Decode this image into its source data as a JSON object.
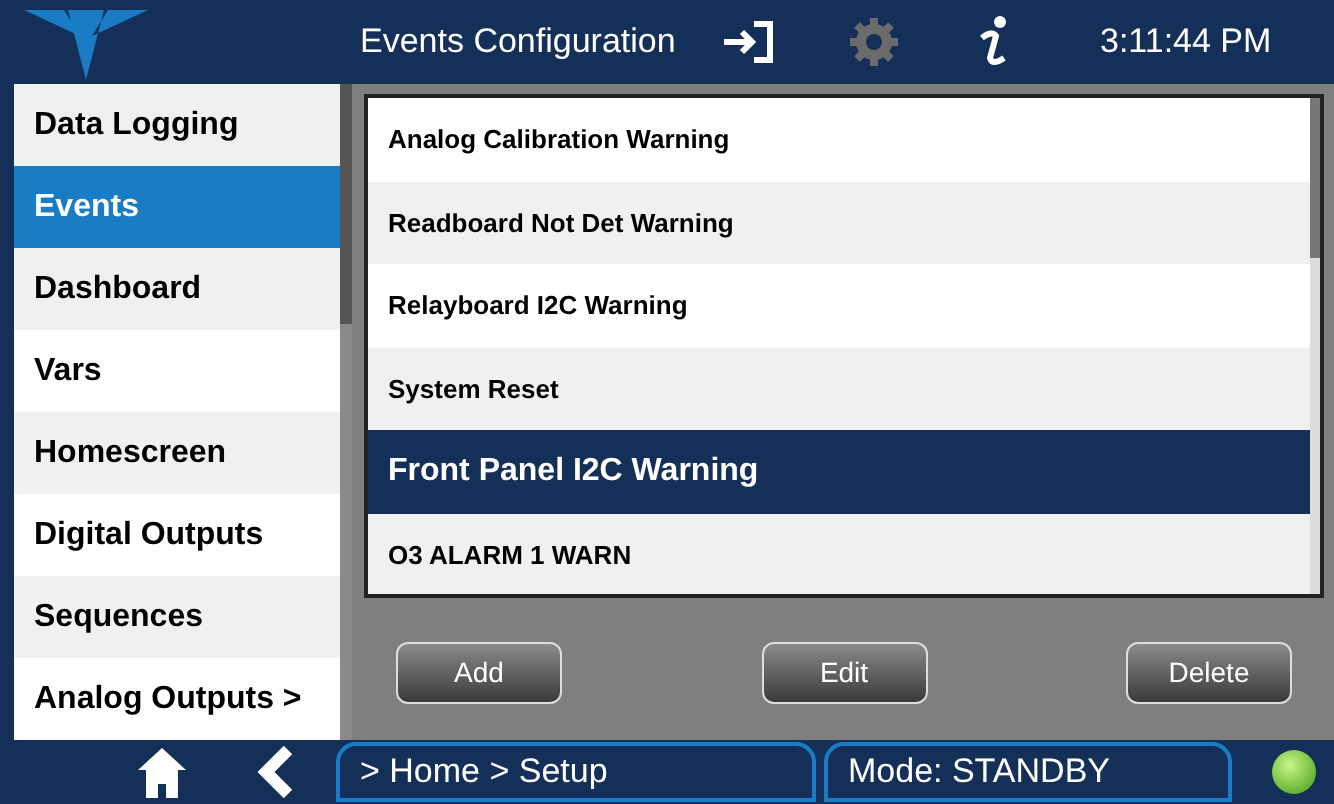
{
  "header": {
    "title": "Events Configuration",
    "time": "3:11:44 PM"
  },
  "sidebar": {
    "items": [
      {
        "label": "Data Logging",
        "selected": false
      },
      {
        "label": "Events",
        "selected": true
      },
      {
        "label": "Dashboard",
        "selected": false
      },
      {
        "label": "Vars",
        "selected": false
      },
      {
        "label": "Homescreen",
        "selected": false
      },
      {
        "label": "Digital Outputs",
        "selected": false
      },
      {
        "label": "Sequences",
        "selected": false
      },
      {
        "label": "Analog Outputs >",
        "selected": false
      }
    ]
  },
  "events": [
    {
      "label": "Analog Calibration Warning",
      "selected": false
    },
    {
      "label": "Readboard Not Det Warning",
      "selected": false
    },
    {
      "label": "Relayboard I2C Warning",
      "selected": false
    },
    {
      "label": "System Reset",
      "selected": false
    },
    {
      "label": "Front Panel I2C Warning",
      "selected": true
    },
    {
      "label": "O3 ALARM 1 WARN",
      "selected": false
    }
  ],
  "buttons": [
    "Add",
    "Edit",
    "Delete"
  ],
  "status_bar": {
    "breadcrumb": "> Home > Setup",
    "mode": "Mode: STANDBY"
  }
}
